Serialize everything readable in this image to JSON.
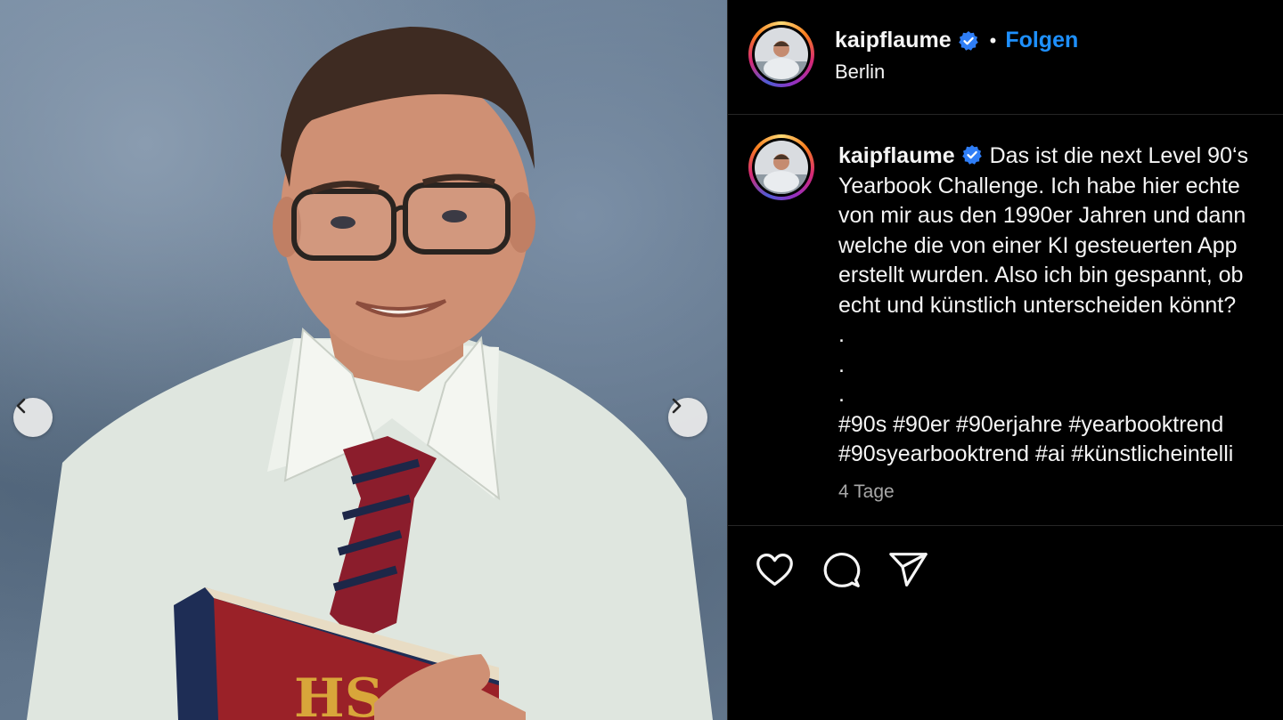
{
  "post": {
    "media_description_icon": "photo",
    "nav": {
      "prev_icon": "chevron-left-icon",
      "next_icon": "chevron-right-icon"
    }
  },
  "header": {
    "username": "kaipflaume",
    "separator": "•",
    "follow_label": "Folgen",
    "location": "Berlin"
  },
  "caption": {
    "username": "kaipflaume",
    "lines": [
      "Das ist die next Level 90‘s",
      "Yearbook Challenge. Ich habe hier echte",
      "von mir aus den 1990er Jahren und dann",
      "welche die von einer KI gesteuerten App",
      "erstellt wurden. Also ich bin gespannt, ob",
      "echt und künstlich unterscheiden könnt?",
      ".",
      ".",
      ".",
      "#90s #90er #90erjahre #yearbooktrend",
      "#90syearbooktrend #ai #künstlicheintelli"
    ],
    "timestamp": "4 Tage"
  },
  "actions": {
    "like_icon": "heart-icon",
    "comment_icon": "comment-icon",
    "share_icon": "send-icon"
  },
  "colors": {
    "background": "#000000",
    "text": "#f5f5f5",
    "muted": "#a8a8a8",
    "follow_blue": "#1e90ff",
    "verified_blue": "#2f7ef7",
    "divider": "#262626"
  }
}
